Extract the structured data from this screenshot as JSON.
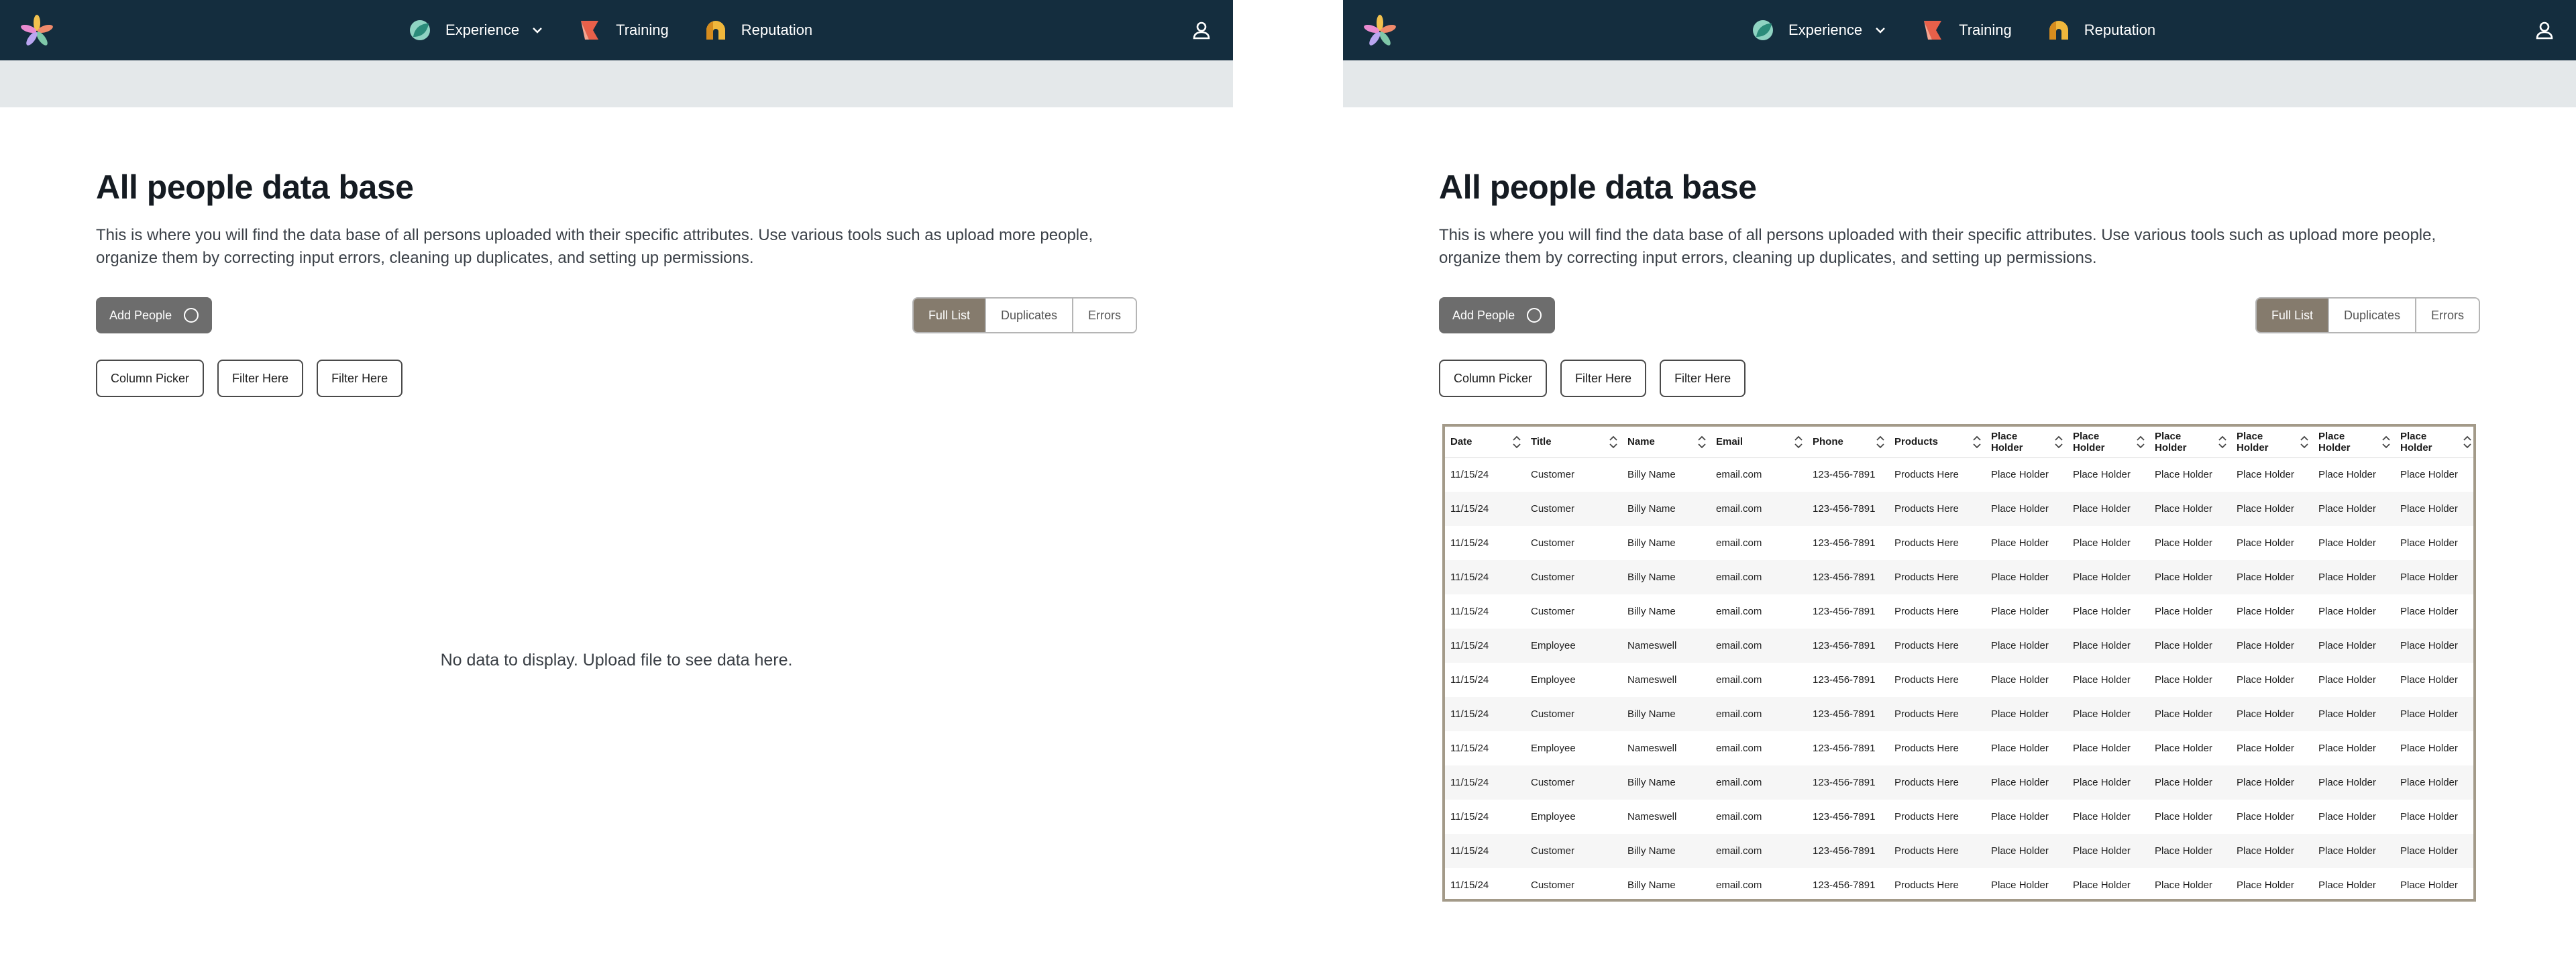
{
  "nav": {
    "items": [
      {
        "label": "Experience",
        "icon": "leaf-circle-icon",
        "has_dropdown": true
      },
      {
        "label": "Training",
        "icon": "arrow-flag-icon",
        "has_dropdown": false
      },
      {
        "label": "Reputation",
        "icon": "arch-icon",
        "has_dropdown": false
      }
    ],
    "user_icon": "user-icon"
  },
  "page": {
    "title": "All people data base",
    "description": "This is where you will find the data base of all persons uploaded with their specific attributes. Use various tools such as upload more people, organize them by correcting input errors, cleaning up duplicates, and setting up permissions.",
    "add_button": "Add People",
    "tabs": [
      "Full List",
      "Duplicates",
      "Errors"
    ],
    "active_tab": "Full List",
    "filters": [
      "Column Picker",
      "Filter Here",
      "Filter Here"
    ],
    "empty_message": "No data to display. Upload file to see data here."
  },
  "table": {
    "columns": [
      "Date",
      "Title",
      "Name",
      "Email",
      "Phone",
      "Products",
      "Place Holder",
      "Place Holder",
      "Place Holder",
      "Place Holder",
      "Place Holder",
      "Place Holder"
    ],
    "rows": [
      [
        "11/15/24",
        "Customer",
        "Billy Name",
        "email.com",
        "123-456-7891",
        "Products Here",
        "Place Holder",
        "Place Holder",
        "Place Holder",
        "Place Holder",
        "Place Holder",
        "Place Holder"
      ],
      [
        "11/15/24",
        "Customer",
        "Billy Name",
        "email.com",
        "123-456-7891",
        "Products Here",
        "Place Holder",
        "Place Holder",
        "Place Holder",
        "Place Holder",
        "Place Holder",
        "Place Holder"
      ],
      [
        "11/15/24",
        "Customer",
        "Billy Name",
        "email.com",
        "123-456-7891",
        "Products Here",
        "Place Holder",
        "Place Holder",
        "Place Holder",
        "Place Holder",
        "Place Holder",
        "Place Holder"
      ],
      [
        "11/15/24",
        "Customer",
        "Billy Name",
        "email.com",
        "123-456-7891",
        "Products Here",
        "Place Holder",
        "Place Holder",
        "Place Holder",
        "Place Holder",
        "Place Holder",
        "Place Holder"
      ],
      [
        "11/15/24",
        "Customer",
        "Billy Name",
        "email.com",
        "123-456-7891",
        "Products Here",
        "Place Holder",
        "Place Holder",
        "Place Holder",
        "Place Holder",
        "Place Holder",
        "Place Holder"
      ],
      [
        "11/15/24",
        "Employee",
        "Nameswell",
        "email.com",
        "123-456-7891",
        "Products Here",
        "Place Holder",
        "Place Holder",
        "Place Holder",
        "Place Holder",
        "Place Holder",
        "Place Holder"
      ],
      [
        "11/15/24",
        "Employee",
        "Nameswell",
        "email.com",
        "123-456-7891",
        "Products Here",
        "Place Holder",
        "Place Holder",
        "Place Holder",
        "Place Holder",
        "Place Holder",
        "Place Holder"
      ],
      [
        "11/15/24",
        "Customer",
        "Billy Name",
        "email.com",
        "123-456-7891",
        "Products Here",
        "Place Holder",
        "Place Holder",
        "Place Holder",
        "Place Holder",
        "Place Holder",
        "Place Holder"
      ],
      [
        "11/15/24",
        "Employee",
        "Nameswell",
        "email.com",
        "123-456-7891",
        "Products Here",
        "Place Holder",
        "Place Holder",
        "Place Holder",
        "Place Holder",
        "Place Holder",
        "Place Holder"
      ],
      [
        "11/15/24",
        "Customer",
        "Billy Name",
        "email.com",
        "123-456-7891",
        "Products Here",
        "Place Holder",
        "Place Holder",
        "Place Holder",
        "Place Holder",
        "Place Holder",
        "Place Holder"
      ],
      [
        "11/15/24",
        "Employee",
        "Nameswell",
        "email.com",
        "123-456-7891",
        "Products Here",
        "Place Holder",
        "Place Holder",
        "Place Holder",
        "Place Holder",
        "Place Holder",
        "Place Holder"
      ],
      [
        "11/15/24",
        "Customer",
        "Billy Name",
        "email.com",
        "123-456-7891",
        "Products Here",
        "Place Holder",
        "Place Holder",
        "Place Holder",
        "Place Holder",
        "Place Holder",
        "Place Holder"
      ],
      [
        "11/15/24",
        "Customer",
        "Billy Name",
        "email.com",
        "123-456-7891",
        "Products Here",
        "Place Holder",
        "Place Holder",
        "Place Holder",
        "Place Holder",
        "Place Holder",
        "Place Holder"
      ]
    ]
  },
  "colors": {
    "nav_bg": "#142d3e",
    "subbar_bg": "#e4e8ea",
    "active_tab_bg": "#857b6d",
    "primary_button_bg": "#6d6d6d",
    "table_border": "#a39a89"
  }
}
